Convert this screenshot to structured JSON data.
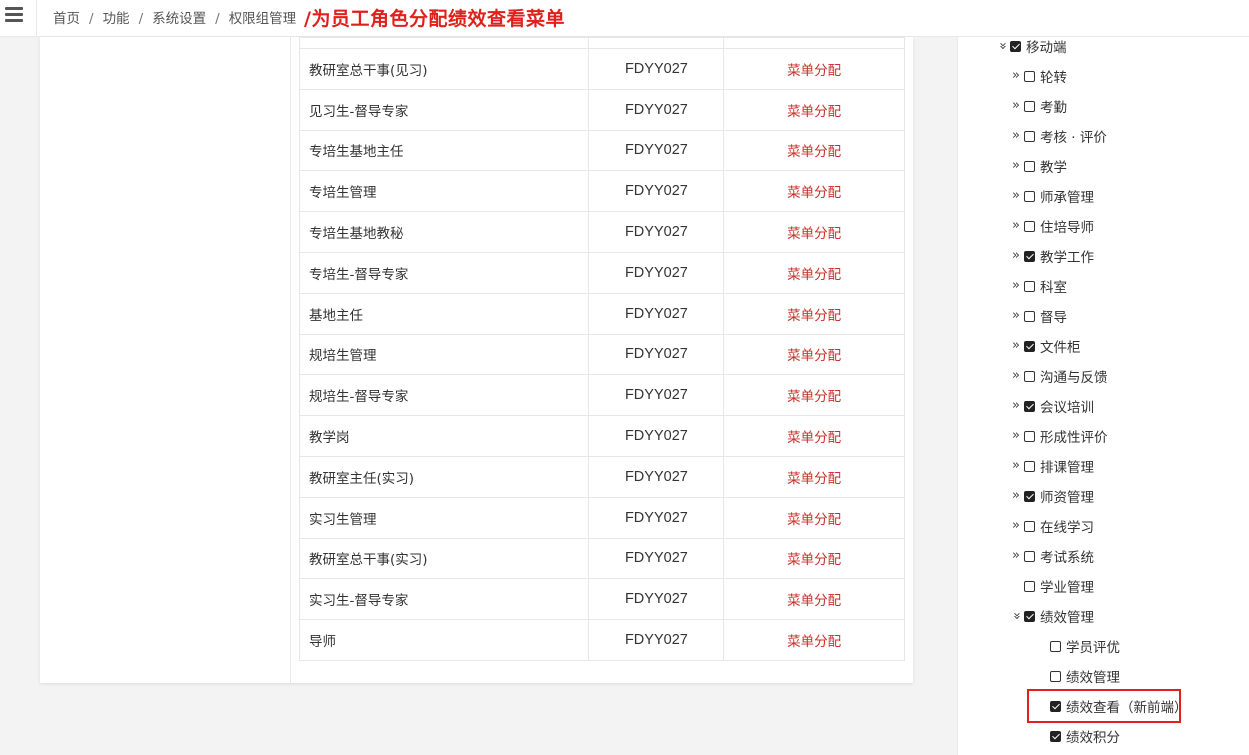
{
  "breadcrumb": {
    "items": [
      "首页",
      "功能",
      "系统设置",
      "权限组管理"
    ],
    "separator": "/"
  },
  "annotation": "/为员工角色分配绩效查看菜单",
  "table": {
    "rows": [
      {
        "name": "教研室总干事(见习)",
        "code": "FDYY027",
        "action": "菜单分配"
      },
      {
        "name": "见习生-督导专家",
        "code": "FDYY027",
        "action": "菜单分配"
      },
      {
        "name": "专培生基地主任",
        "code": "FDYY027",
        "action": "菜单分配"
      },
      {
        "name": "专培生管理",
        "code": "FDYY027",
        "action": "菜单分配"
      },
      {
        "name": "专培生基地教秘",
        "code": "FDYY027",
        "action": "菜单分配"
      },
      {
        "name": "专培生-督导专家",
        "code": "FDYY027",
        "action": "菜单分配"
      },
      {
        "name": "基地主任",
        "code": "FDYY027",
        "action": "菜单分配"
      },
      {
        "name": "规培生管理",
        "code": "FDYY027",
        "action": "菜单分配"
      },
      {
        "name": "规培生-督导专家",
        "code": "FDYY027",
        "action": "菜单分配"
      },
      {
        "name": "教学岗",
        "code": "FDYY027",
        "action": "菜单分配"
      },
      {
        "name": "教研室主任(实习)",
        "code": "FDYY027",
        "action": "菜单分配"
      },
      {
        "name": "实习生管理",
        "code": "FDYY027",
        "action": "菜单分配"
      },
      {
        "name": "教研室总干事(实习)",
        "code": "FDYY027",
        "action": "菜单分配"
      },
      {
        "name": "实习生-督导专家",
        "code": "FDYY027",
        "action": "菜单分配"
      },
      {
        "name": "导师",
        "code": "FDYY027",
        "action": "菜单分配"
      }
    ]
  },
  "tree": {
    "nodes": [
      {
        "label": "移动端",
        "level": 0,
        "toggle": "down",
        "checked": true
      },
      {
        "label": "轮转",
        "level": 1,
        "toggle": "right",
        "checked": false
      },
      {
        "label": "考勤",
        "level": 1,
        "toggle": "right",
        "checked": false
      },
      {
        "label": "考核 · 评价",
        "level": 1,
        "toggle": "right",
        "checked": false
      },
      {
        "label": "教学",
        "level": 1,
        "toggle": "right",
        "checked": false
      },
      {
        "label": "师承管理",
        "level": 1,
        "toggle": "right",
        "checked": false
      },
      {
        "label": "住培导师",
        "level": 1,
        "toggle": "right",
        "checked": false
      },
      {
        "label": "教学工作",
        "level": 1,
        "toggle": "right",
        "checked": true
      },
      {
        "label": "科室",
        "level": 1,
        "toggle": "right",
        "checked": false
      },
      {
        "label": "督导",
        "level": 1,
        "toggle": "right",
        "checked": false
      },
      {
        "label": "文件柜",
        "level": 1,
        "toggle": "right",
        "checked": true
      },
      {
        "label": "沟通与反馈",
        "level": 1,
        "toggle": "right",
        "checked": false
      },
      {
        "label": "会议培训",
        "level": 1,
        "toggle": "right",
        "checked": true
      },
      {
        "label": "形成性评价",
        "level": 1,
        "toggle": "right",
        "checked": false
      },
      {
        "label": "排课管理",
        "level": 1,
        "toggle": "right",
        "checked": false
      },
      {
        "label": "师资管理",
        "level": 1,
        "toggle": "right",
        "checked": true
      },
      {
        "label": "在线学习",
        "level": 1,
        "toggle": "right",
        "checked": false
      },
      {
        "label": "考试系统",
        "level": 1,
        "toggle": "right",
        "checked": false
      },
      {
        "label": "学业管理",
        "level": 1,
        "toggle": "none",
        "checked": false
      },
      {
        "label": "绩效管理",
        "level": 1,
        "toggle": "down",
        "checked": true
      },
      {
        "label": "学员评优",
        "level": 2,
        "toggle": "none",
        "checked": false
      },
      {
        "label": "绩效管理",
        "level": 2,
        "toggle": "none",
        "checked": false
      },
      {
        "label": "绩效查看（新前端）",
        "level": 2,
        "toggle": "none",
        "checked": true
      },
      {
        "label": "绩效积分",
        "level": 2,
        "toggle": "none",
        "checked": true
      }
    ]
  },
  "colors": {
    "accent_red": "#e0201b",
    "action_link": "#c9302c"
  }
}
